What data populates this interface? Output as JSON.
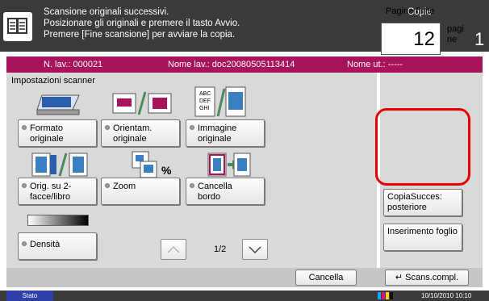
{
  "header": {
    "message_lines": [
      "Scansione originali successivi.",
      "Posizionare gli originali e premere il tasto Avvio.",
      "Premere [Fine scansione] per avviare la copia."
    ],
    "copies_label": "Copie",
    "copies_value": "1"
  },
  "jobbar": {
    "job_no": "N. lav.: 000021",
    "job_name": "Nome lav.: doc20080505113414",
    "user_name": "Nome ut.: -----"
  },
  "scanner": {
    "title": "Impostazioni scanner",
    "options": [
      {
        "label": "Formato originale",
        "icon": "original-size-icon"
      },
      {
        "label": "Orientam. originale",
        "icon": "original-orientation-icon"
      },
      {
        "label": "Immagine originale",
        "icon": "original-image-icon"
      },
      {
        "label": "Orig. su 2-facce/libro",
        "icon": "duplex-book-icon"
      },
      {
        "label": "Zoom",
        "icon": "zoom-icon"
      },
      {
        "label": "Cancella bordo",
        "icon": "border-erase-icon"
      },
      {
        "label": "Densità",
        "icon": "density-icon"
      }
    ],
    "page_indicator": "1/2"
  },
  "finished_pages": {
    "label": "Pagine finite",
    "value": "12",
    "unit": "pagine"
  },
  "right_buttons": {
    "copy_after": "CopiaSucces: posteriore",
    "insert_sheet": "Inserimento foglio"
  },
  "bottom": {
    "cancel": "Cancella",
    "scan_complete": "Scans.compl."
  },
  "status": {
    "label": "Stato",
    "datetime": "10/10/2010  10:10"
  },
  "colors": {
    "accent": "#a9135c",
    "highlight": "#e60000",
    "header_bg": "#3a3a3a",
    "status_bg": "#2f3fa8"
  }
}
